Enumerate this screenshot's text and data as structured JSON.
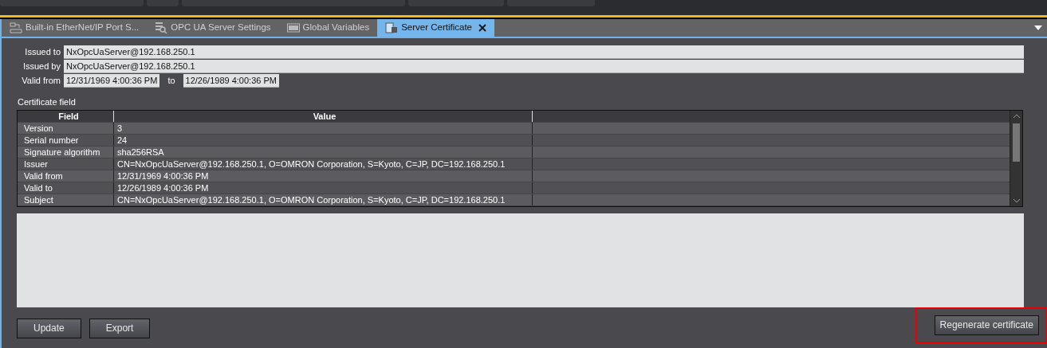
{
  "tabs": [
    {
      "label": "Built-in EtherNet/IP Port S...",
      "selected": false
    },
    {
      "label": "OPC UA Server Settings",
      "selected": false
    },
    {
      "label": "Global Variables",
      "selected": false
    },
    {
      "label": "Server Certificate",
      "selected": true
    }
  ],
  "issued_to": {
    "label": "Issued to",
    "value": "NxOpcUaServer@192.168.250.1"
  },
  "issued_by": {
    "label": "Issued by",
    "value": "NxOpcUaServer@192.168.250.1"
  },
  "validity": {
    "label": "Valid from",
    "from": "12/31/1969 4:00:36 PM",
    "separator": "to",
    "to": "12/26/1989 4:00:36 PM"
  },
  "certificate_fields": {
    "title": "Certificate field",
    "columns": [
      "Field",
      "Value"
    ],
    "rows": [
      [
        "Version",
        "3"
      ],
      [
        "Serial number",
        "24"
      ],
      [
        "Signature algorithm",
        "sha256RSA"
      ],
      [
        "Issuer",
        "CN=NxOpcUaServer@192.168.250.1, O=OMRON Corporation, S=Kyoto, C=JP, DC=192.168.250.1"
      ],
      [
        "Valid from",
        "12/31/1969 4:00:36 PM"
      ],
      [
        "Valid to",
        "12/26/1989 4:00:36 PM"
      ],
      [
        "Subject",
        "CN=NxOpcUaServer@192.168.250.1, O=OMRON Corporation, S=Kyoto, C=JP, DC=192.168.250.1"
      ]
    ]
  },
  "buttons": [
    {
      "label": "Update",
      "highlighted": false
    },
    {
      "label": "Export",
      "highlighted": false
    }
  ],
  "regenerate_button": {
    "label": "Regenerate certificate",
    "highlighted": true
  }
}
